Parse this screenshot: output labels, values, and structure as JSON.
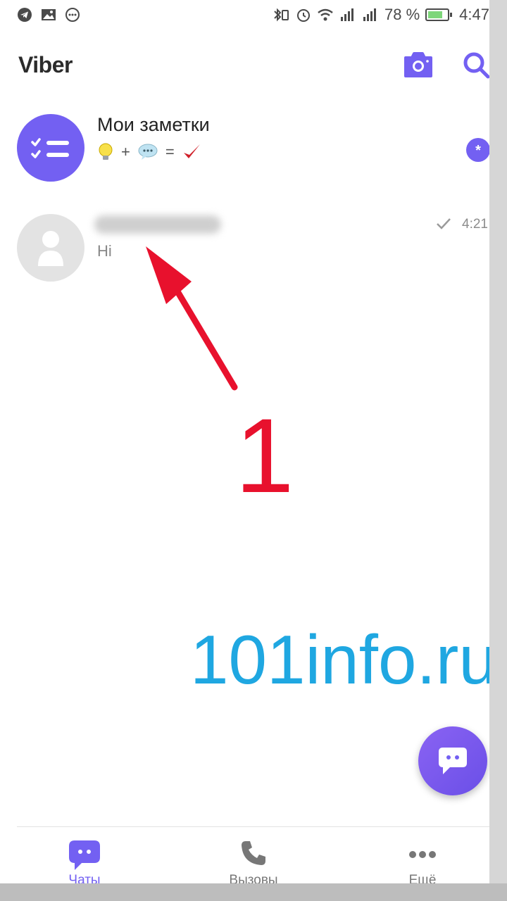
{
  "status_bar": {
    "battery_percent": "78 %",
    "time": "4:47",
    "battery_level": 0.78
  },
  "app": {
    "title": "Viber",
    "accent_color": "#7360f2"
  },
  "chats": [
    {
      "name": "Мои заметки",
      "preview": {
        "plus": "+",
        "equals": "="
      },
      "badge": "*"
    },
    {
      "name": "",
      "preview": "Hi",
      "time": "4:21"
    }
  ],
  "annotation": {
    "number": "1",
    "watermark": "101info.ru"
  },
  "bottom_nav": {
    "items": [
      {
        "label": "Чаты",
        "active": true
      },
      {
        "label": "Вызовы",
        "active": false
      },
      {
        "label": "Ещё",
        "active": false
      }
    ]
  }
}
